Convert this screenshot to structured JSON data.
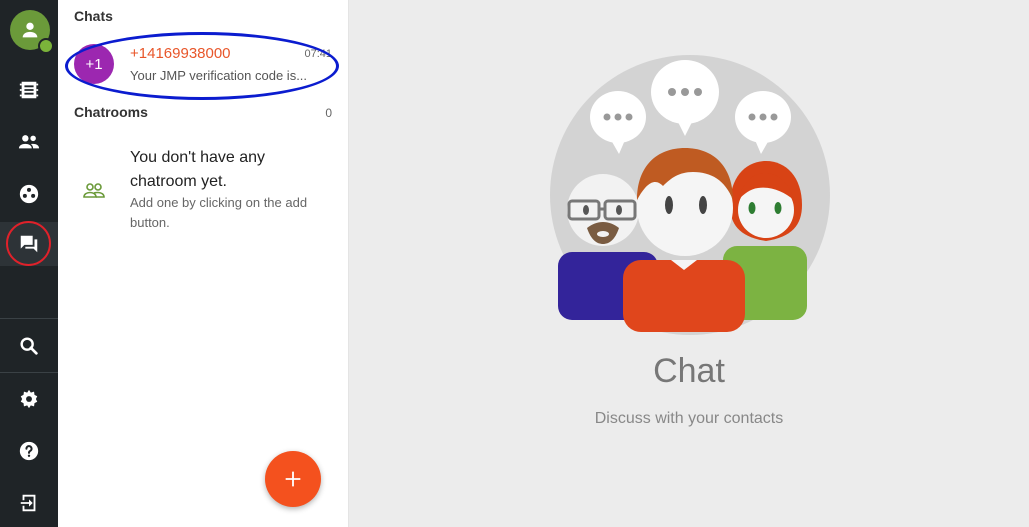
{
  "sidebar": {
    "items": [
      {
        "name": "contacts-book"
      },
      {
        "name": "contacts"
      },
      {
        "name": "groups"
      },
      {
        "name": "chat"
      },
      {
        "name": "search"
      },
      {
        "name": "settings"
      },
      {
        "name": "help"
      },
      {
        "name": "logout"
      }
    ],
    "active": "chat"
  },
  "chats": {
    "heading": "Chats",
    "items": [
      {
        "avatar_text": "+1",
        "avatar_color": "#9c27b0",
        "name": "+14169938000",
        "time": "07:41",
        "preview": "Your JMP verification code is..."
      }
    ]
  },
  "chatrooms": {
    "heading": "Chatrooms",
    "count": "0",
    "empty_title": "You don't have any chatroom yet.",
    "empty_subtitle": "Add one by clicking on the add button."
  },
  "main": {
    "title": "Chat",
    "subtitle": "Discuss with your contacts"
  },
  "colors": {
    "accent": "#f4511e",
    "rail": "#1f2427",
    "green": "#6b9a3a"
  }
}
